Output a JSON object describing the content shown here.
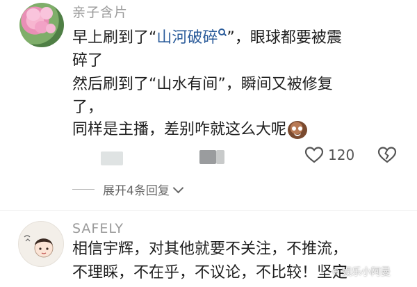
{
  "comments": [
    {
      "username": "亲子含片",
      "lines": {
        "l1_pre": "早上刷到了“",
        "l1_link": "山河破碎",
        "l1_post": "”，眼球都要被震",
        "l2": "碎了",
        "l3": "然后刷到了“山水有间”，瞬间又被修复",
        "l4": "了，",
        "l5": "同样是主播，差别咋就这么大呢"
      },
      "like_count": "120",
      "expand_label": "展开4条回复"
    },
    {
      "username": "SAFELY",
      "lines": {
        "l6": "相信宇辉，对其他就要不关注，不推流，",
        "l7": "不理睬，不在乎，不议论，不比较！坚定"
      }
    }
  ],
  "watermark": "娱乐小阿曼",
  "colors": {
    "link": "#2a5b9a",
    "username": "#9a9a9a",
    "text": "#1f1f1f"
  },
  "icons": {
    "search": "search-icon",
    "like": "heart-icon",
    "dislike": "broken-heart-icon",
    "expand": "chevron-down-icon",
    "emoji": "laughing-face-emoji-icon"
  }
}
